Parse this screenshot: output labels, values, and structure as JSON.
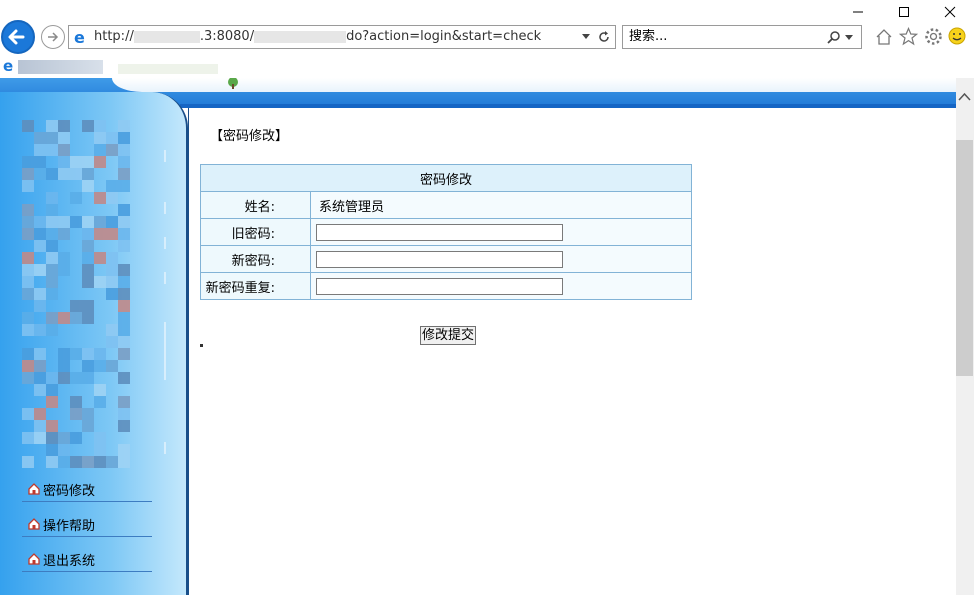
{
  "browser": {
    "url_prefix": "http://",
    "url_mid": ".3:8080/",
    "url_suffix": "do?action=login&start=check",
    "search_placeholder": "搜索..."
  },
  "page": {
    "section_title": "【密码修改】"
  },
  "form": {
    "header": "密码修改",
    "name_label": "姓名:",
    "name_value": "系统管理员",
    "old_password_label": "旧密码:",
    "new_password_label": "新密码:",
    "confirm_password_label": "新密码重复:",
    "submit_label": "修改提交"
  },
  "sidebar": {
    "items": [
      {
        "label": "密码修改",
        "icon": "home-icon"
      },
      {
        "label": "操作帮助",
        "icon": "home-icon"
      },
      {
        "label": "退出系统",
        "icon": "home-icon"
      }
    ]
  },
  "colors": {
    "accent": "#1b78d9",
    "sidebar_light": "#c4e8fc",
    "table_header": "#ddf1fb",
    "table_border": "#82b3d6"
  }
}
